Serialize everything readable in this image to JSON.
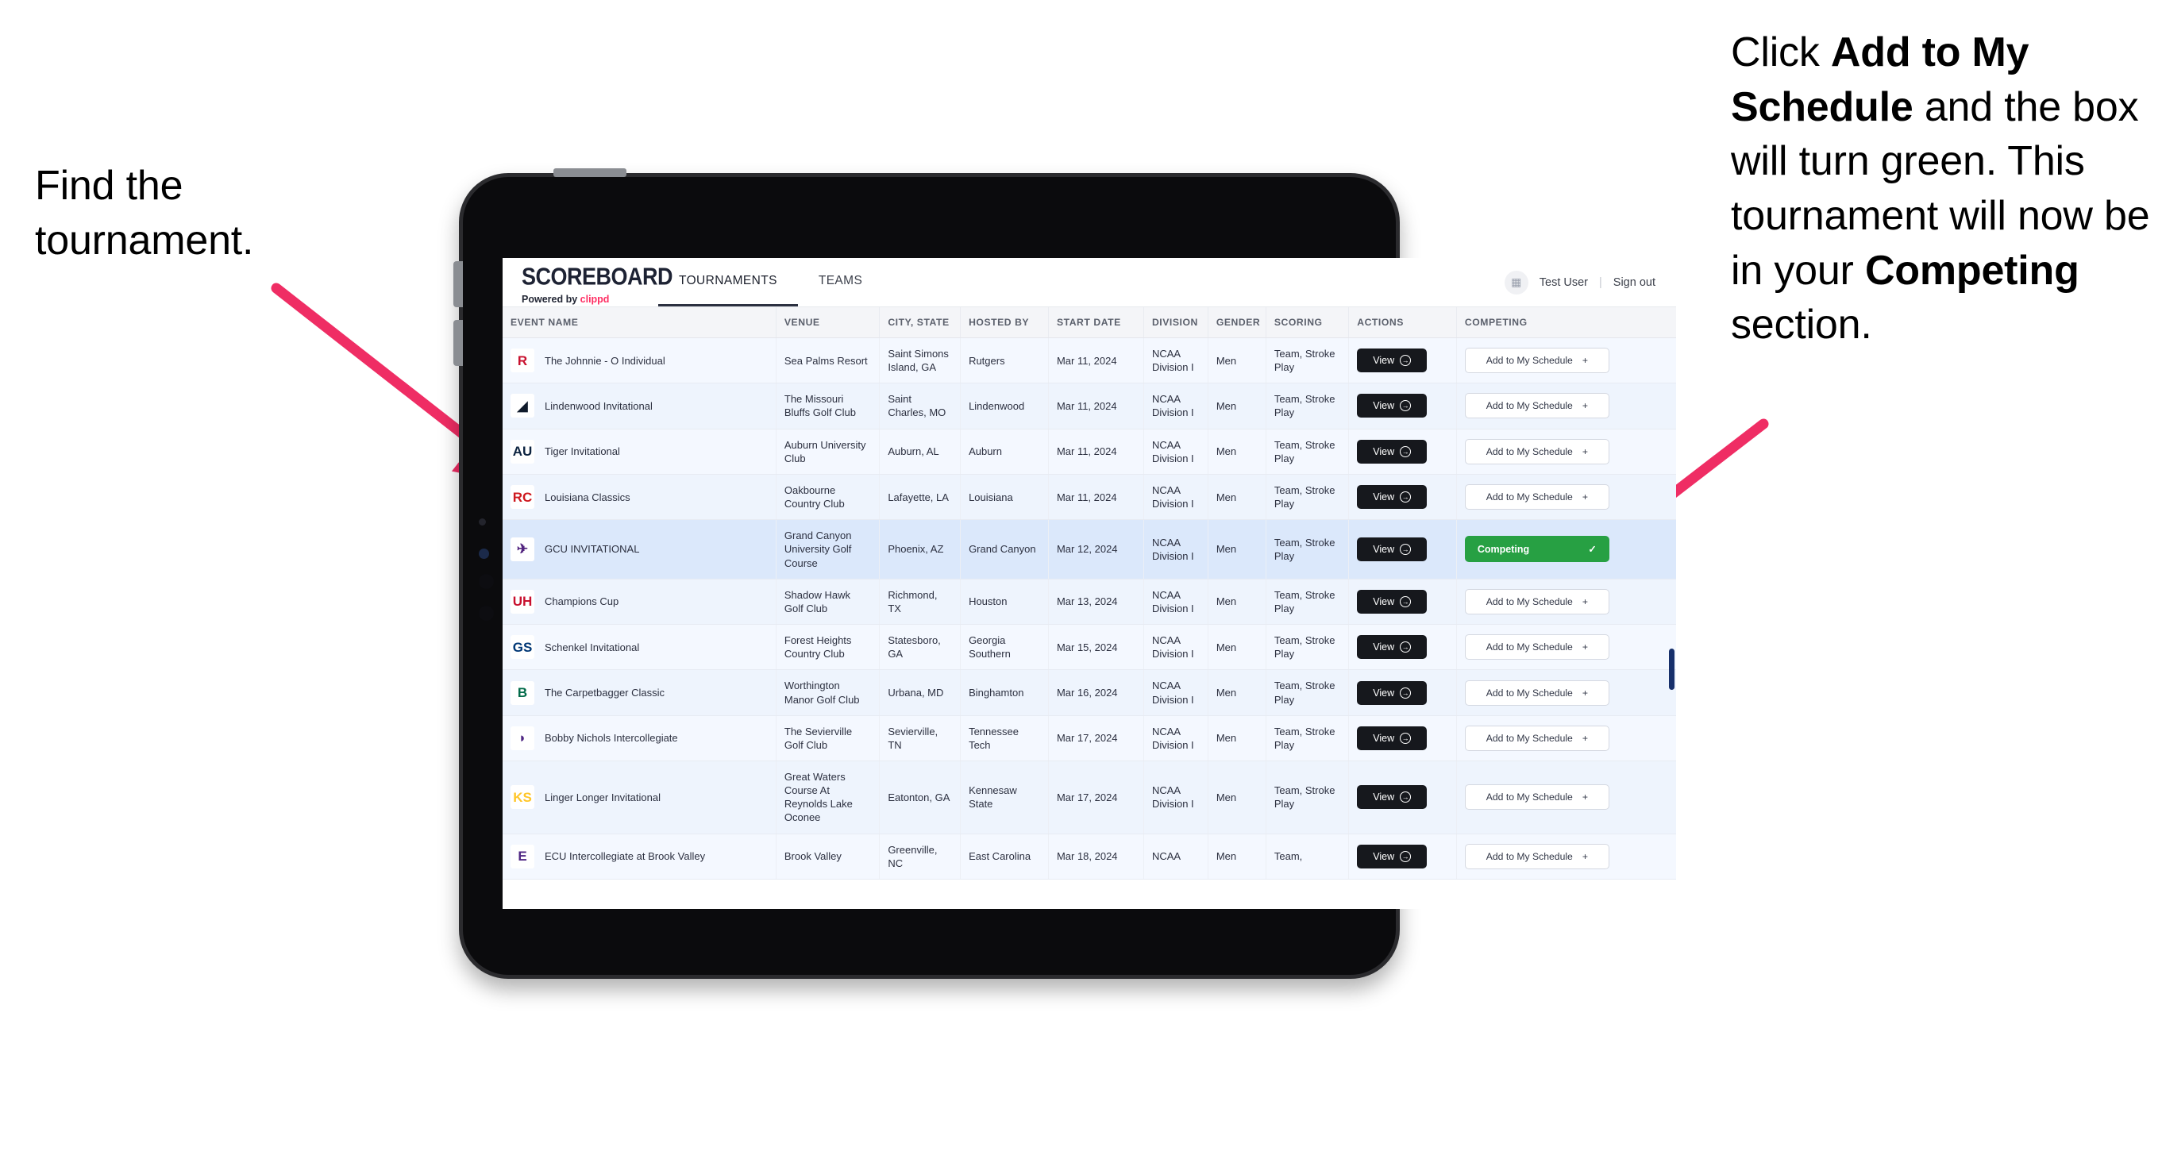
{
  "annotations": {
    "left": {
      "line1": "Find the",
      "line2": "tournament."
    },
    "right": {
      "text_parts": [
        {
          "t": "Click ",
          "bold": false
        },
        {
          "t": "Add to My Schedule",
          "bold": true
        },
        {
          "t": " and the box will turn green. This tournament will now be in your ",
          "bold": false
        },
        {
          "t": "Competing",
          "bold": true
        },
        {
          "t": " section.",
          "bold": false
        }
      ]
    },
    "arrow_color": "#ef2d64"
  },
  "app": {
    "brand": {
      "name": "SCOREBOARD",
      "powered_prefix": "Powered by ",
      "powered_brand": "clippd"
    },
    "tabs": [
      {
        "label": "TOURNAMENTS",
        "active": true
      },
      {
        "label": "TEAMS",
        "active": false
      }
    ],
    "user": {
      "avatar_icon": "user-avatar-icon",
      "name": "Test User",
      "separator": "|",
      "signout": "Sign out"
    },
    "table": {
      "columns": [
        "EVENT NAME",
        "VENUE",
        "CITY, STATE",
        "HOSTED BY",
        "START DATE",
        "DIVISION",
        "GENDER",
        "SCORING",
        "ACTIONS",
        "COMPETING"
      ],
      "view_label": "View",
      "add_label": "Add to My Schedule",
      "add_plus": "+",
      "competing_label": "Competing",
      "competing_check": "✓",
      "rows": [
        {
          "event": "The Johnnie - O Individual",
          "logo_text": "R",
          "logo_bg": "#ffffff",
          "logo_fg": "#c8102e",
          "venue": "Sea Palms Resort",
          "city": "Saint Simons Island, GA",
          "host": "Rutgers",
          "date": "Mar 11, 2024",
          "division": "NCAA Division I",
          "gender": "Men",
          "scoring": "Team, Stroke Play",
          "competing": false
        },
        {
          "event": "Lindenwood Invitational",
          "logo_text": "◢",
          "logo_bg": "#ffffff",
          "logo_fg": "#0f1a2b",
          "venue": "The Missouri Bluffs Golf Club",
          "city": "Saint Charles, MO",
          "host": "Lindenwood",
          "date": "Mar 11, 2024",
          "division": "NCAA Division I",
          "gender": "Men",
          "scoring": "Team, Stroke Play",
          "competing": false
        },
        {
          "event": "Tiger Invitational",
          "logo_text": "AU",
          "logo_bg": "#ffffff",
          "logo_fg": "#0c2340",
          "venue": "Auburn University Club",
          "city": "Auburn, AL",
          "host": "Auburn",
          "date": "Mar 11, 2024",
          "division": "NCAA Division I",
          "gender": "Men",
          "scoring": "Team, Stroke Play",
          "competing": false
        },
        {
          "event": "Louisiana Classics",
          "logo_text": "RC",
          "logo_bg": "#ffffff",
          "logo_fg": "#ce181e",
          "venue": "Oakbourne Country Club",
          "city": "Lafayette, LA",
          "host": "Louisiana",
          "date": "Mar 11, 2024",
          "division": "NCAA Division I",
          "gender": "Men",
          "scoring": "Team, Stroke Play",
          "competing": false
        },
        {
          "event": "GCU INVITATIONAL",
          "logo_text": "✈",
          "logo_bg": "#ffffff",
          "logo_fg": "#52247f",
          "venue": "Grand Canyon University Golf Course",
          "city": "Phoenix, AZ",
          "host": "Grand Canyon",
          "date": "Mar 12, 2024",
          "division": "NCAA Division I",
          "gender": "Men",
          "scoring": "Team, Stroke Play",
          "competing": true,
          "selected": true
        },
        {
          "event": "Champions Cup",
          "logo_text": "UH",
          "logo_bg": "#ffffff",
          "logo_fg": "#c8102e",
          "venue": "Shadow Hawk Golf Club",
          "city": "Richmond, TX",
          "host": "Houston",
          "date": "Mar 13, 2024",
          "division": "NCAA Division I",
          "gender": "Men",
          "scoring": "Team, Stroke Play",
          "competing": false
        },
        {
          "event": "Schenkel Invitational",
          "logo_text": "GS",
          "logo_bg": "#ffffff",
          "logo_fg": "#003775",
          "venue": "Forest Heights Country Club",
          "city": "Statesboro, GA",
          "host": "Georgia Southern",
          "date": "Mar 15, 2024",
          "division": "NCAA Division I",
          "gender": "Men",
          "scoring": "Team, Stroke Play",
          "competing": false
        },
        {
          "event": "The Carpetbagger Classic",
          "logo_text": "B",
          "logo_bg": "#ffffff",
          "logo_fg": "#026b49",
          "venue": "Worthington Manor Golf Club",
          "city": "Urbana, MD",
          "host": "Binghamton",
          "date": "Mar 16, 2024",
          "division": "NCAA Division I",
          "gender": "Men",
          "scoring": "Team, Stroke Play",
          "competing": false
        },
        {
          "event": "Bobby Nichols Intercollegiate",
          "logo_text": "◗",
          "logo_bg": "#ffffff",
          "logo_fg": "#4f2683",
          "venue": "The Sevierville Golf Club",
          "city": "Sevierville, TN",
          "host": "Tennessee Tech",
          "date": "Mar 17, 2024",
          "division": "NCAA Division I",
          "gender": "Men",
          "scoring": "Team, Stroke Play",
          "competing": false
        },
        {
          "event": "Linger Longer Invitational",
          "logo_text": "KS",
          "logo_bg": "#ffffff",
          "logo_fg": "#ffc629",
          "venue": "Great Waters Course At Reynolds Lake Oconee",
          "city": "Eatonton, GA",
          "host": "Kennesaw State",
          "date": "Mar 17, 2024",
          "division": "NCAA Division I",
          "gender": "Men",
          "scoring": "Team, Stroke Play",
          "competing": false
        },
        {
          "event": "ECU Intercollegiate at Brook Valley",
          "logo_text": "E",
          "logo_bg": "#ffffff",
          "logo_fg": "#4f2683",
          "venue": "Brook Valley",
          "city": "Greenville, NC",
          "host": "East Carolina",
          "date": "Mar 18, 2024",
          "division": "NCAA",
          "gender": "Men",
          "scoring": "Team,",
          "competing": false,
          "clipped": true
        }
      ]
    }
  }
}
